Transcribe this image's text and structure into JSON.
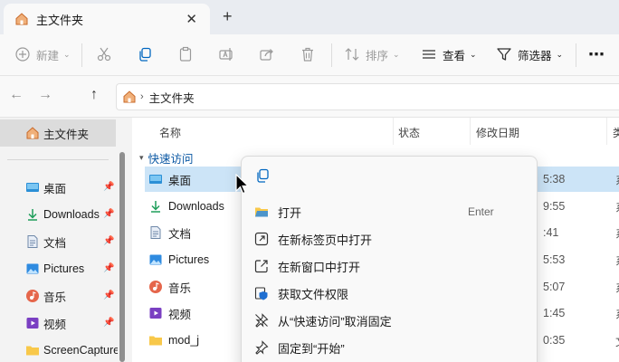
{
  "tab": {
    "title": "主文件夹",
    "close": "✕",
    "new_tab": "+"
  },
  "toolbar": {
    "new_label": "新建",
    "sort_label": "排序",
    "view_label": "查看",
    "filter_label": "筛选器",
    "more": "⋯"
  },
  "nav": {
    "back": "←",
    "forward": "→",
    "up": "↑"
  },
  "address": {
    "sep": "›",
    "path": "主文件夹"
  },
  "sidebar": {
    "home": "主文件夹",
    "items": [
      {
        "label": "桌面",
        "icon": "desktop-icon"
      },
      {
        "label": "Downloads",
        "icon": "download-icon"
      },
      {
        "label": "文档",
        "icon": "document-icon"
      },
      {
        "label": "Pictures",
        "icon": "pictures-icon"
      },
      {
        "label": "音乐",
        "icon": "music-icon"
      },
      {
        "label": "视频",
        "icon": "video-icon"
      },
      {
        "label": "ScreenCapture",
        "icon": "folder-icon"
      }
    ]
  },
  "columns": {
    "name": "名称",
    "status": "状态",
    "modified": "修改日期",
    "type": "类"
  },
  "group": {
    "label": "快速访问"
  },
  "rows": [
    {
      "name": "桌面",
      "date": "5:38",
      "type": "系"
    },
    {
      "name": "Downloads",
      "date": "9:55",
      "type": "系"
    },
    {
      "name": "文档",
      "date": ":41",
      "type": "系"
    },
    {
      "name": "Pictures",
      "date": "5:53",
      "type": "系"
    },
    {
      "name": "音乐",
      "date": "5:07",
      "type": "系"
    },
    {
      "name": "视频",
      "date": "1:45",
      "type": "系"
    },
    {
      "name": "mod_j",
      "date": "0:35",
      "type": "文"
    }
  ],
  "context_menu": {
    "open": "打开",
    "open_shortcut": "Enter",
    "open_new_tab": "在新标签页中打开",
    "open_new_window": "在新窗口中打开",
    "get_permission": "获取文件权限",
    "unpin_quick": "从“快速访问”取消固定",
    "pin_start": "固定到“开始”"
  },
  "colors": {
    "accent": "#0067c0",
    "selection": "#cce4f7",
    "folder": "#f8c84a"
  }
}
